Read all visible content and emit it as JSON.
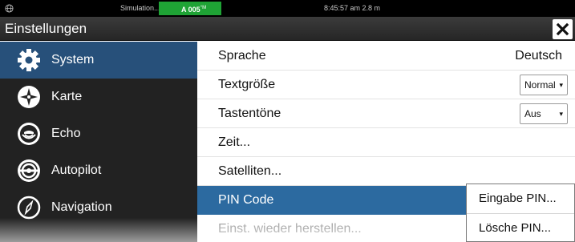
{
  "statusbar": {
    "simulation_text": "Simulation...",
    "badge_text": "A 005",
    "badge_unit": "°M",
    "time_text": "8:45:57 am   2.8 m",
    "badge_color": "#1fa335"
  },
  "window": {
    "title": "Einstellungen",
    "close_icon": "close-icon"
  },
  "sidebar": {
    "selected_index": 0,
    "items": [
      {
        "label": "System",
        "icon": "gear-icon"
      },
      {
        "label": "Karte",
        "icon": "chart-compass-icon"
      },
      {
        "label": "Echo",
        "icon": "echo-sonar-icon"
      },
      {
        "label": "Autopilot",
        "icon": "steering-wheel-icon"
      },
      {
        "label": "Navigation",
        "icon": "navigation-arrow-icon"
      }
    ]
  },
  "settings": {
    "rows": [
      {
        "label": "Sprache",
        "value": "Deutsch"
      },
      {
        "label": "Textgröße",
        "dropdown": "Normal"
      },
      {
        "label": "Tastentöne",
        "dropdown": "Aus"
      },
      {
        "label": "Zeit..."
      },
      {
        "label": "Satelliten..."
      },
      {
        "label": "PIN Code"
      },
      {
        "label": "Einst. wieder herstellen..."
      }
    ],
    "highlighted_index": 5
  },
  "context_menu": {
    "items": [
      "Eingabe PIN...",
      "Lösche PIN..."
    ]
  },
  "colors": {
    "sidebar_bg": "#222222",
    "sidebar_selected": "#27507a",
    "row_highlight": "#2c6aa0"
  }
}
